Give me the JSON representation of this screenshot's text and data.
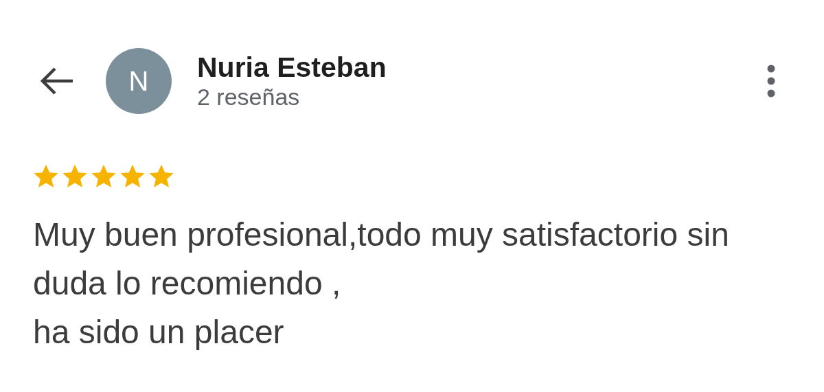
{
  "reviewer": {
    "initial": "N",
    "name": "Nuria Esteban",
    "review_count": "2 reseñas"
  },
  "review": {
    "stars": 5,
    "text": "Muy buen profesional,todo muy satisfactorio sin duda lo recomiendo ,\nha sido un placer"
  }
}
